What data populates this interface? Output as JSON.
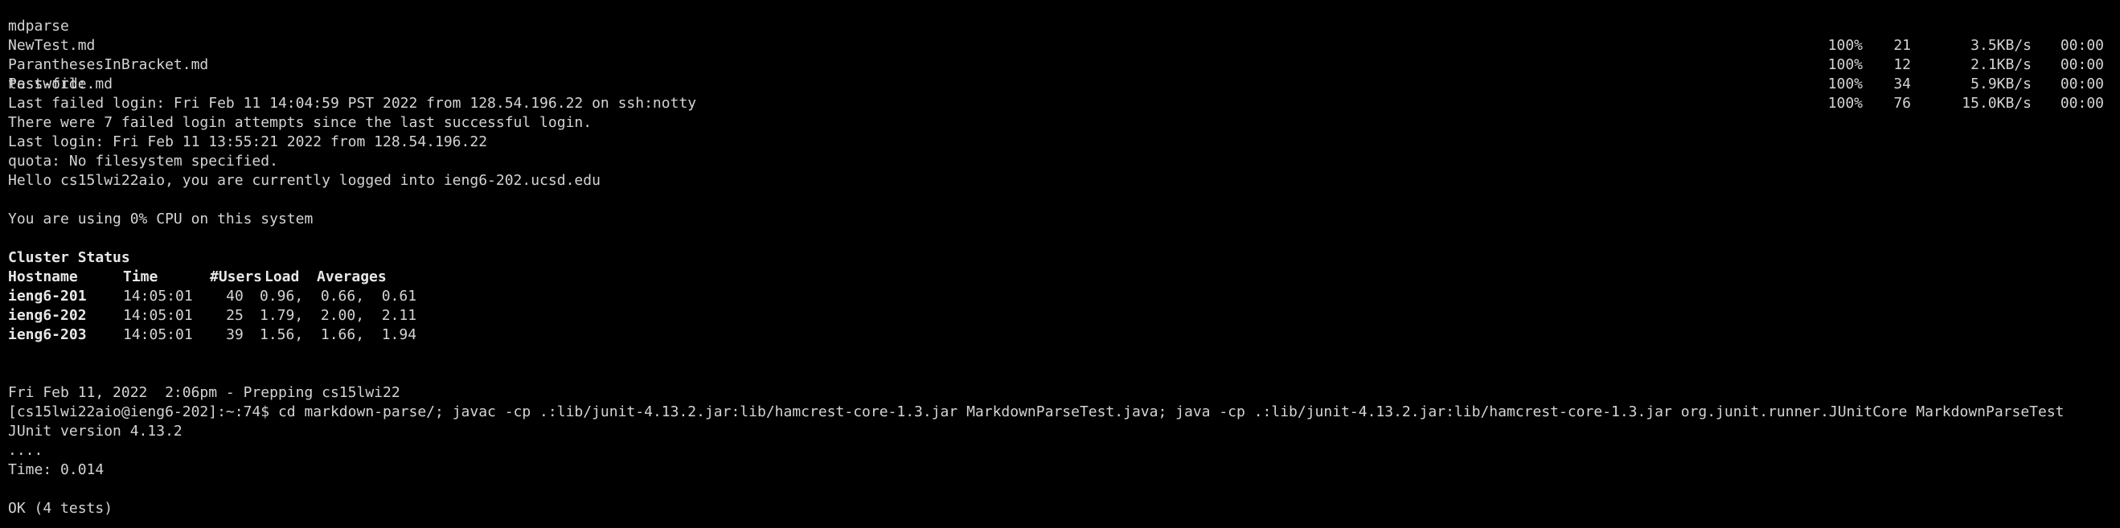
{
  "transfers": [
    {
      "file": "mdparse",
      "pct": "100%",
      "size": "21",
      "rate": "3.5KB/s",
      "eta": "00:00"
    },
    {
      "file": "NewTest.md",
      "pct": "100%",
      "size": "12",
      "rate": "2.1KB/s",
      "eta": "00:00"
    },
    {
      "file": "ParanthesesInBracket.md",
      "pct": "100%",
      "size": "34",
      "rate": "5.9KB/s",
      "eta": "00:00"
    },
    {
      "file": "test-file.md",
      "pct": "100%",
      "size": "76",
      "rate": "15.0KB/s",
      "eta": "00:00"
    }
  ],
  "login": {
    "password_prompt": "Password:",
    "last_failed": "Last failed login: Fri Feb 11 14:04:59 PST 2022 from 128.54.196.22 on ssh:notty",
    "failed_attempts": "There were 7 failed login attempts since the last successful login.",
    "last_login": "Last login: Fri Feb 11 13:55:21 2022 from 128.54.196.22",
    "quota": "quota: No filesystem specified.",
    "hello": "Hello cs15lwi22aio, you are currently logged into ieng6-202.ucsd.edu",
    "cpu": "You are using 0% CPU on this system"
  },
  "cluster": {
    "title": "Cluster Status",
    "headers": {
      "host": "Hostname",
      "time": "Time",
      "users": "#Users",
      "load": "Load  Averages"
    },
    "rows": [
      {
        "host": "ieng6-201",
        "time": "14:05:01",
        "users": "40",
        "load": "0.96,  0.66,  0.61"
      },
      {
        "host": "ieng6-202",
        "time": "14:05:01",
        "users": "25",
        "load": "1.79,  2.00,  2.11"
      },
      {
        "host": "ieng6-203",
        "time": "14:05:01",
        "users": "39",
        "load": "1.56,  1.66,  1.94"
      }
    ]
  },
  "session": {
    "date_line": "Fri Feb 11, 2022  2:06pm - Prepping cs15lwi22",
    "prompt": "[cs15lwi22aio@ieng6-202]:~:74$ ",
    "command": "cd markdown-parse/; javac -cp .:lib/junit-4.13.2.jar:lib/hamcrest-core-1.3.jar MarkdownParseTest.java; java -cp .:lib/junit-4.13.2.jar:lib/hamcrest-core-1.3.jar org.junit.runner.JUnitCore MarkdownParseTest",
    "junit_version": "JUnit version 4.13.2",
    "dots": "....",
    "time": "Time: 0.014",
    "result": "OK (4 tests)"
  },
  "colors": {
    "background": "#000000",
    "foreground": "#d4d4d4"
  }
}
